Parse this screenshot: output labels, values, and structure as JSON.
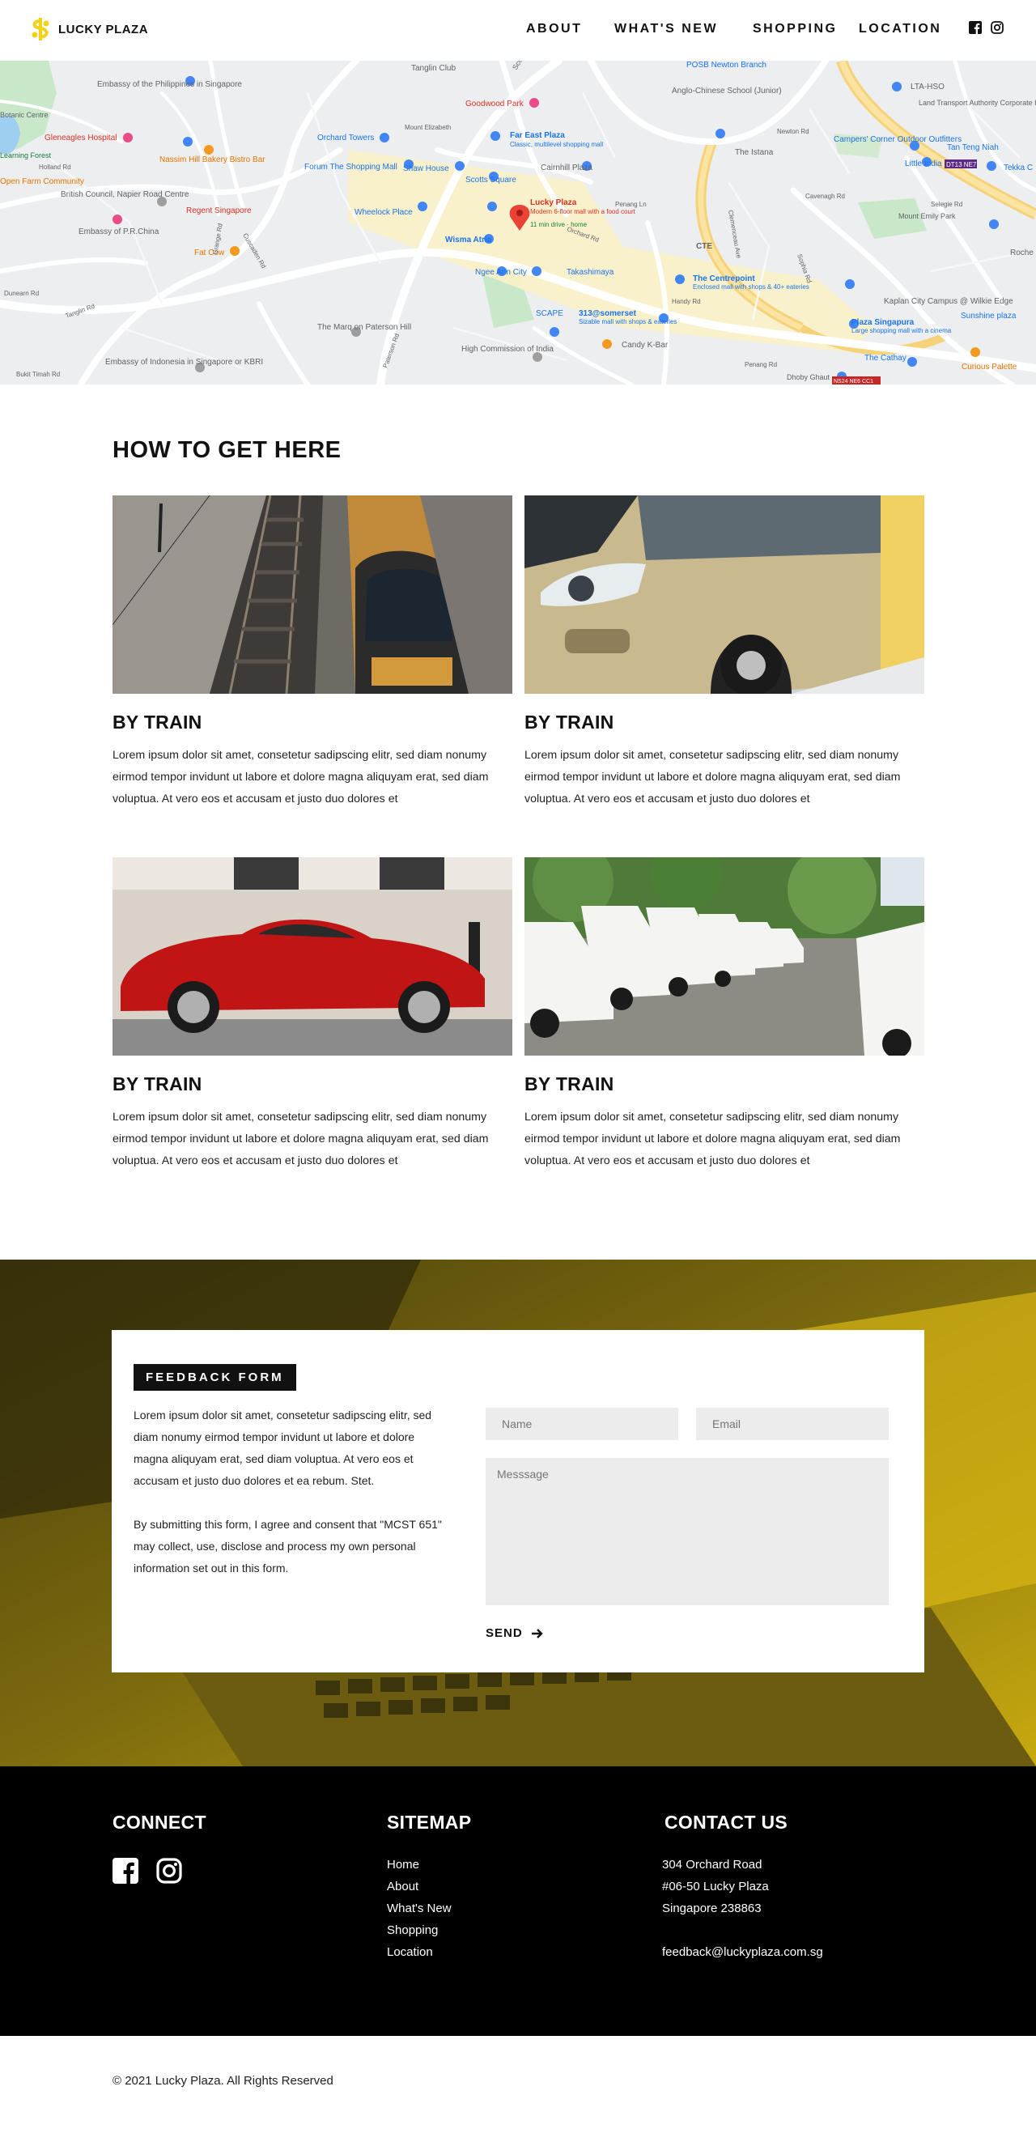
{
  "brand": {
    "name": "LUCKY PLAZA",
    "accent": "#f2d219"
  },
  "nav": {
    "items": [
      "ABOUT",
      "WHAT'S NEW",
      "SHOPPING",
      "LOCATION"
    ],
    "social_icons": [
      "facebook-icon",
      "instagram-icon"
    ]
  },
  "map": {
    "labels": [
      "Tanglin Club",
      "Scotts Rd",
      "POSB Newton Branch",
      "Embassy of the Philippines in Singapore",
      "Botanic Centre",
      "Learning Forest",
      "Goodwood Park",
      "Anglo-Chinese School (Junior)",
      "LTA-HSO",
      "Land Transport Authority Corporate Headquarters",
      "Gleneagles Hospital",
      "Orchard Towers",
      "Far East Plaza",
      "Classic, multilevel shopping mall",
      "Nassim Hill Bakery Bistro Bar",
      "Forum The Shopping Mall",
      "Shaw House",
      "Cairnhill Plaza",
      "The Istana",
      "Campers' Corner Outdoor Outfitters",
      "Tan Teng Niah",
      "Little India",
      "Tekka C",
      "Open Farm Community",
      "British Council, Napier Road Centre",
      "Scotts Square",
      "Regent Singapore",
      "Wheelock Place",
      "Lucky Plaza",
      "Modern 6-floor mall with a food court",
      "11 min drive · home",
      "Mount Emily Park",
      "Embassy of P.R.China",
      "Fat Cow",
      "Wisma Atria",
      "CTE",
      "Roche",
      "Ngee Ann City",
      "Takashimaya",
      "The Centrepoint",
      "Enclosed mall with shops & 40+ eateries",
      "Kaplan City Campus @ Wilkie Edge",
      "Sunshine plaza",
      "The Marq on Paterson Hill",
      "SCAPE",
      "313@somerset",
      "Sizable mall with shops & eateries",
      "Plaza Singapura",
      "Large shopping mall with a cinema",
      "High Commission of India",
      "Candy K-Bar",
      "Embassy of Indonesia in Singapore or KBRI",
      "The Cathay",
      "Curious Palette",
      "Holland Rd",
      "Penang Rd",
      "Dhoby Ghaut",
      "Grange Rd",
      "Tanglin Rd",
      "Orchard Rd",
      "Cuscaden Rd",
      "Paterson Rd",
      "Mount Elizabeth",
      "Bukit Timah Rd",
      "Dunearn Rd",
      "Newton Rd",
      "Clemenceau Ave",
      "Cavenagh Rd",
      "Penang Ln",
      "Sophia Rd",
      "Selegie Rd",
      "Handy Rd"
    ],
    "badges": [
      "DT13 NE7",
      "NS24 NE6 CC1"
    ]
  },
  "how_to_get_here": {
    "title": "HOW TO GET HERE",
    "cards": [
      {
        "image": "train-photo",
        "title": "BY TRAIN",
        "text": "Lorem ipsum dolor sit amet, consetetur sadipscing elitr, sed diam nonumy eirmod tempor invidunt ut labore et dolore magna aliquyam erat, sed diam voluptua. At vero eos et accusam et justo duo dolores et"
      },
      {
        "image": "bus-photo",
        "title": "BY TRAIN",
        "text": "Lorem ipsum dolor sit amet, consetetur sadipscing elitr, sed diam nonumy eirmod tempor invidunt ut labore et dolore magna aliquyam erat, sed diam voluptua. At vero eos et accusam et justo duo dolores et"
      },
      {
        "image": "car-photo",
        "title": "BY TRAIN",
        "text": "Lorem ipsum dolor sit amet, consetetur sadipscing elitr, sed diam nonumy eirmod tempor invidunt ut labore et dolore magna aliquyam erat, sed diam voluptua. At vero eos et accusam et justo duo dolores et"
      },
      {
        "image": "vans-photo",
        "title": "BY TRAIN",
        "text": "Lorem ipsum dolor sit amet, consetetur sadipscing elitr, sed diam nonumy eirmod tempor invidunt ut labore et dolore magna aliquyam erat, sed diam voluptua. At vero eos et accusam et justo duo dolores et"
      }
    ]
  },
  "feedback": {
    "badge": "FEEDBACK FORM",
    "intro": "Lorem ipsum dolor sit amet, consetetur sadipscing elitr, sed diam nonumy eirmod tempor invidunt ut labore et dolore magna aliquyam erat, sed diam voluptua. At vero eos et accusam et justo duo dolores et ea rebum. Stet.",
    "consent": "By submitting this form, I agree and consent that \"MCST 651\" may collect, use, disclose and process my own personal information set out in this form.",
    "name_placeholder": "Name",
    "email_placeholder": "Email",
    "message_placeholder": "Messsage",
    "send_label": "SEND",
    "send_icon": "arrow-right-icon"
  },
  "footer": {
    "connect": {
      "title": "CONNECT",
      "icons": [
        "facebook-icon",
        "instagram-icon"
      ]
    },
    "sitemap": {
      "title": "SITEMAP",
      "links": [
        "Home",
        "About",
        "What's New",
        "Shopping",
        "Location"
      ]
    },
    "contact": {
      "title": "CONTACT US",
      "lines": [
        "304 Orchard Road",
        "#06-50 Lucky Plaza",
        "Singapore 238863",
        "",
        "feedback@luckyplaza.com.sg"
      ]
    },
    "copyright": "© 2021 Lucky Plaza. All Rights Reserved"
  }
}
